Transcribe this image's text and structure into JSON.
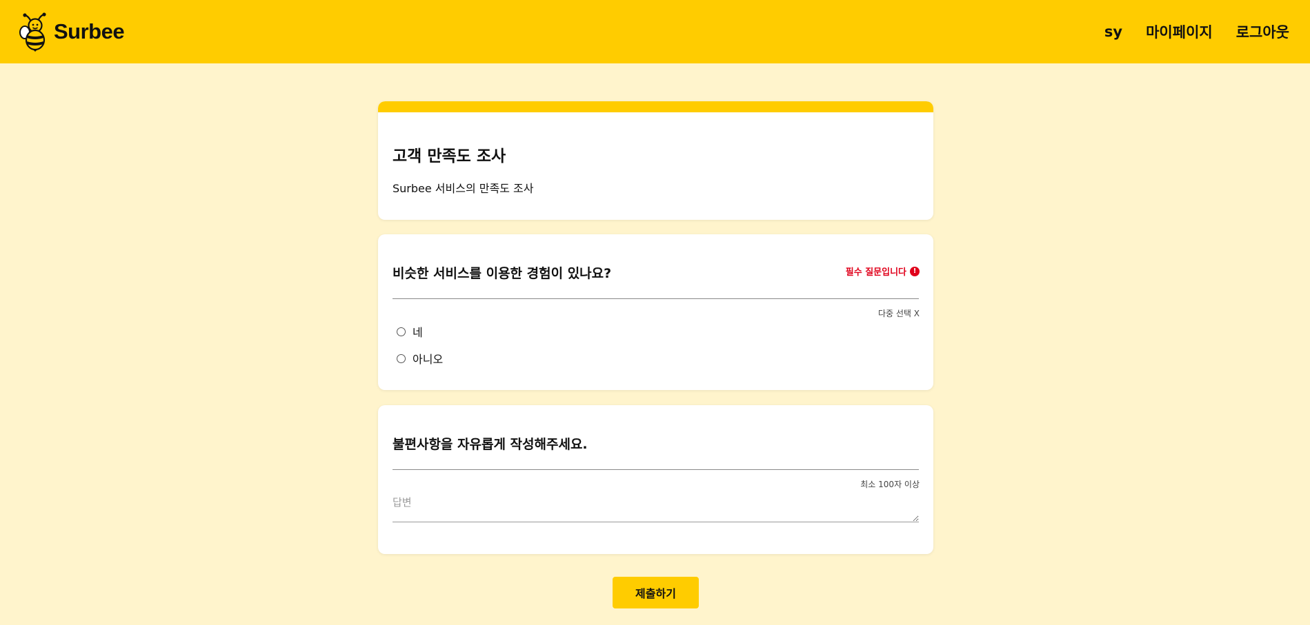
{
  "header": {
    "logo_text": "Surbee",
    "nav": {
      "user": "sy",
      "mypage": "마이페이지",
      "logout": "로그아웃"
    }
  },
  "survey": {
    "title": "고객 만족도 조사",
    "description": "Surbee 서비스의 만족도 조사"
  },
  "question1": {
    "title": "비슷한 서비스를 이용한 경험이 있나요?",
    "required_label": "필수 질문입니다",
    "hint": "다중 선택 X",
    "options": [
      "네",
      "아니오"
    ]
  },
  "question2": {
    "title": "불편사항을 자유롭게 작성해주세요.",
    "hint": "최소 100자 이상",
    "placeholder": "답변"
  },
  "submit_label": "제출하기",
  "colors": {
    "brand": "#ffcc00",
    "background": "#fff4cc",
    "required": "#e0001b"
  }
}
